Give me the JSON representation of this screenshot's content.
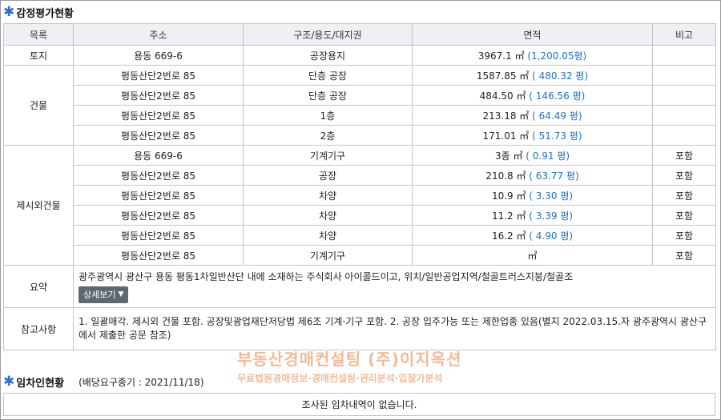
{
  "appraisal": {
    "title": "감정평가현황",
    "headers": [
      "목록",
      "주소",
      "구조/용도/대지권",
      "면적",
      "비고"
    ],
    "land": {
      "category": "토지",
      "address": "용동 669-6",
      "structure": "공장용지",
      "area": "3967.1 ㎡ ",
      "pyeong": "(1,200.05평)",
      "note": ""
    },
    "building_category": "건물",
    "building_rows": [
      {
        "address": "평동산단2번로 85",
        "structure": "단층 공장",
        "area": "1587.85 ㎡ ",
        "pyeong": "( 480.32 평)"
      },
      {
        "address": "평동산단2번로 85",
        "structure": "단층 공장",
        "area": "484.50 ㎡ ",
        "pyeong": "( 146.56 평)"
      },
      {
        "address": "평동산단2번로 85",
        "structure": "1층",
        "area": "213.18 ㎡ ",
        "pyeong": "( 64.49 평)"
      },
      {
        "address": "평동산단2번로 85",
        "structure": "2층",
        "area": "171.01 ㎡ ",
        "pyeong": "( 51.73 평)"
      }
    ],
    "extra_category": "제시외건물",
    "extra_rows": [
      {
        "address": "용동 669-6",
        "structure": "기계기구",
        "area": "3종 ㎡ ",
        "pyeong": "( 0.91 평)",
        "note": "포함"
      },
      {
        "address": "평동산단2번로 85",
        "structure": "공장",
        "area": "210.8 ㎡ ",
        "pyeong": "( 63.77 평)",
        "note": "포함"
      },
      {
        "address": "평동산단2번로 85",
        "structure": "차양",
        "area": "10.9 ㎡ ",
        "pyeong": "( 3.30 평)",
        "note": "포함"
      },
      {
        "address": "평동산단2번로 85",
        "structure": "차양",
        "area": "11.2 ㎡ ",
        "pyeong": "( 3.39 평)",
        "note": "포함"
      },
      {
        "address": "평동산단2번로 85",
        "structure": "차양",
        "area": "16.2 ㎡ ",
        "pyeong": "( 4.90 평)",
        "note": "포함"
      },
      {
        "address": "평동산단2번로 85",
        "structure": "기계기구",
        "area": "㎡",
        "pyeong": "",
        "note": "포함"
      }
    ],
    "summary": {
      "label": "요약",
      "text": "광주광역시 광산구 용동 평동1차일반산단 내에 소재하는 주식회사 아이콜드이고, 위치/일반공업지역/철골트러스지붕/철골조",
      "button": "상세보기"
    },
    "reference": {
      "label": "참고사항",
      "text": "1. 일괄매각. 제시외 건물 포함. 공장및광업재단저당법 제6조 기계·기구 포함. 2. 공장 입주가능 또는 제한업종 있음(별지 2022.03.15.자 광주광역시 광산구에서 제출한 공문 참조)"
    }
  },
  "watermark": {
    "line1": "부동산경매컨설팅 (주)이지옥션",
    "line2": "무료법원경매정보·경매컨설팅·권리분석·입찰가분석"
  },
  "tenant": {
    "title": "임차인현황",
    "deadline": "(배당요구종기 : 2021/11/18)",
    "empty_message": "조사된 임차내역이 없습니다."
  }
}
